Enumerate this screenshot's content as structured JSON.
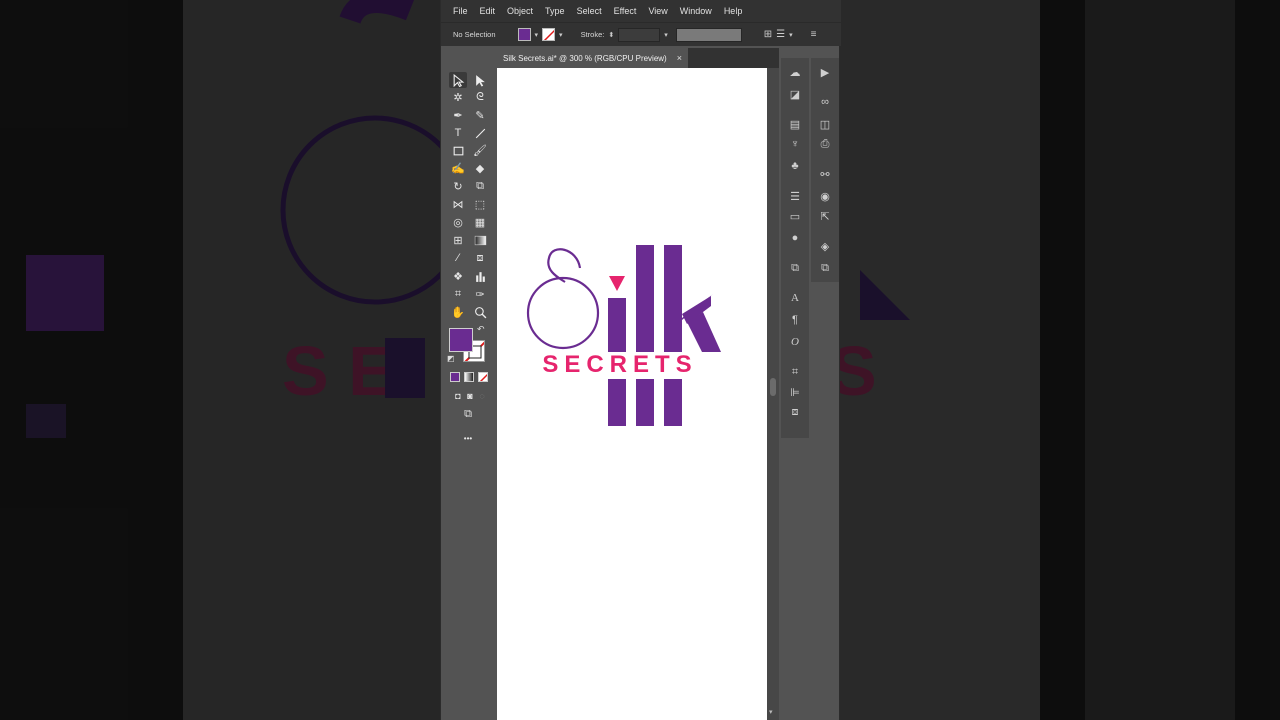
{
  "menu": [
    "File",
    "Edit",
    "Object",
    "Type",
    "Select",
    "Effect",
    "View",
    "Window",
    "Help"
  ],
  "control_bar": {
    "selection_label": "No Selection",
    "stroke_label": "Stroke:",
    "fill_color": "#6a2c91",
    "stroke_color": "none"
  },
  "document": {
    "title": "Silk Secrets.ai* @ 300 % (RGB/CPU Preview)",
    "close_glyph": "×"
  },
  "artwork": {
    "logo_word": "ilk",
    "tagline": "SECRETS",
    "primary_color": "#6a2c91",
    "accent_color": "#e6246d"
  },
  "toolbar": {
    "fill_color": "#6a2c91",
    "more_glyph": "•••"
  },
  "colors": {
    "app_bg": "#535353",
    "chrome": "#323232",
    "panel": "#474747",
    "canvas": "#ffffff"
  }
}
